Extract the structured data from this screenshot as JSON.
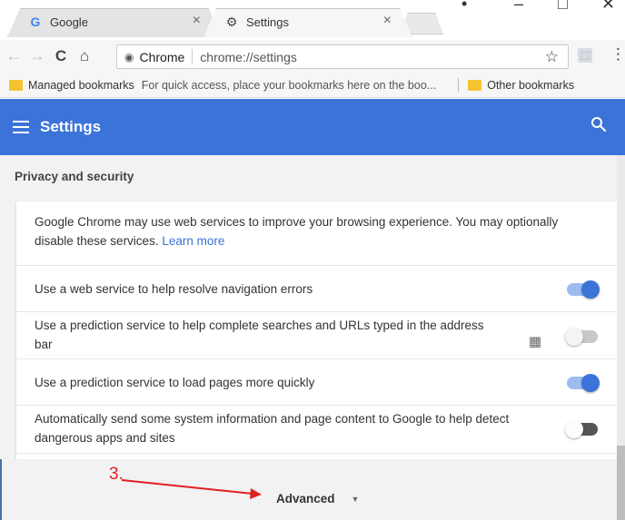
{
  "browser": {
    "tabs": [
      {
        "title": "Google",
        "close": "×"
      },
      {
        "title": "Settings",
        "close": "×"
      }
    ],
    "toolbar": {
      "back": "←",
      "forward": "→",
      "reload": "C",
      "home": "⌂",
      "site_label": "Chrome",
      "url": "chrome://settings",
      "star": "☆",
      "menu": "⋮"
    },
    "bookmarks": {
      "managed": "Managed bookmarks",
      "hint": "For quick access, place your bookmarks here on the boo...",
      "other": "Other bookmarks"
    }
  },
  "header": {
    "title": "Settings"
  },
  "section": {
    "title": "Privacy and security",
    "intro": "Google Chrome may use web services to improve your browsing experience. You may optionally disable these services.",
    "learn_more": "Learn more",
    "rows": [
      {
        "label": "Use a web service to help resolve navigation errors",
        "toggle": "on"
      },
      {
        "label": "Use a prediction service to help complete searches and URLs typed in the address bar",
        "toggle": "off",
        "managed": true
      },
      {
        "label": "Use a prediction service to load pages more quickly",
        "toggle": "on"
      },
      {
        "label": "Automatically send some system information and page content to Google to help detect dangerous apps and sites",
        "toggle": "off"
      }
    ]
  },
  "advanced": {
    "label": "Advanced",
    "chevron": "▼"
  },
  "annotation": {
    "step": "3."
  },
  "colors": {
    "accent": "#3b73d8",
    "annotation": "#e02020"
  }
}
